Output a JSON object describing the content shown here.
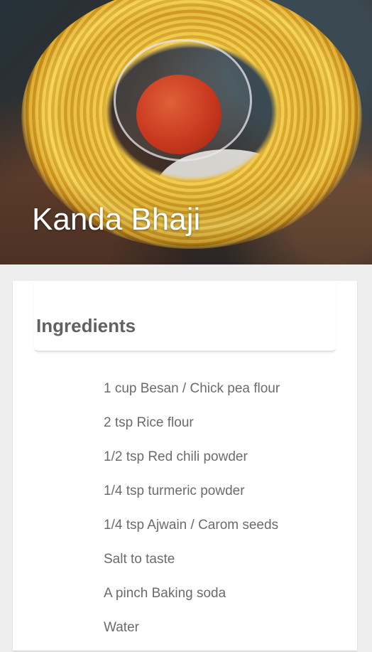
{
  "recipe": {
    "title": "Kanda Bhaji"
  },
  "ingredients": {
    "heading": "Ingredients",
    "items": [
      "1 cup Besan / Chick pea flour",
      "2 tsp Rice flour",
      "1/2 tsp Red chili powder",
      "1/4 tsp turmeric powder",
      "1/4 tsp Ajwain / Carom seeds",
      "Salt to taste",
      "A pinch Baking soda",
      "Water"
    ]
  }
}
